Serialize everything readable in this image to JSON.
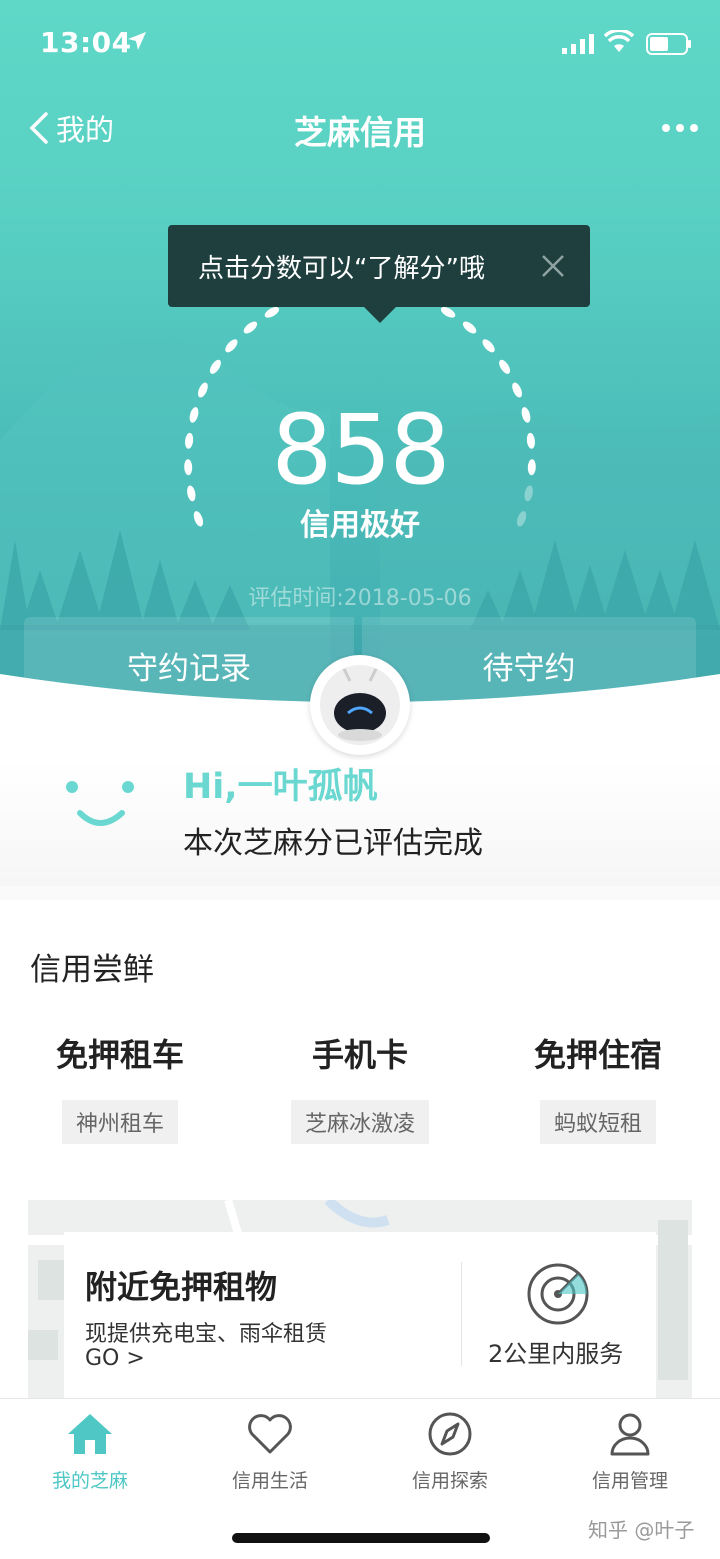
{
  "status_bar": {
    "time": "13:04"
  },
  "nav": {
    "back_label": "我的",
    "title": "芝麻信用"
  },
  "tooltip": {
    "text": "点击分数可以“了解分”哦"
  },
  "score": {
    "value": "858",
    "level": "信用极好",
    "eval_time": "评估时间:2018-05-06"
  },
  "record_tabs": {
    "left": "守约记录",
    "right": "待守约"
  },
  "greeting": {
    "hi": "Hi,一叶孤帆",
    "message": "本次芝麻分已评估完成"
  },
  "section": {
    "title": "信用尝鲜"
  },
  "trials": [
    {
      "name": "免押租车",
      "tag": "神州租车"
    },
    {
      "name": "手机卡",
      "tag": "芝麻冰激凌"
    },
    {
      "name": "免押住宿",
      "tag": "蚂蚁短租"
    }
  ],
  "nearby": {
    "title": "附近免押租物",
    "desc": "现提供充电宝、雨伞租赁",
    "go": "GO >",
    "radius": "2公里内服务"
  },
  "tabbar": [
    {
      "label": "我的芝麻",
      "icon": "home-icon",
      "active": true
    },
    {
      "label": "信用生活",
      "icon": "heart-icon",
      "active": false
    },
    {
      "label": "信用探索",
      "icon": "compass-icon",
      "active": false
    },
    {
      "label": "信用管理",
      "icon": "person-icon",
      "active": false
    }
  ],
  "watermark": "知乎 @叶子",
  "colors": {
    "accent": "#4fc7c4",
    "hero_top": "#5fd8c8",
    "tooltip_bg": "#1f3f3f"
  }
}
